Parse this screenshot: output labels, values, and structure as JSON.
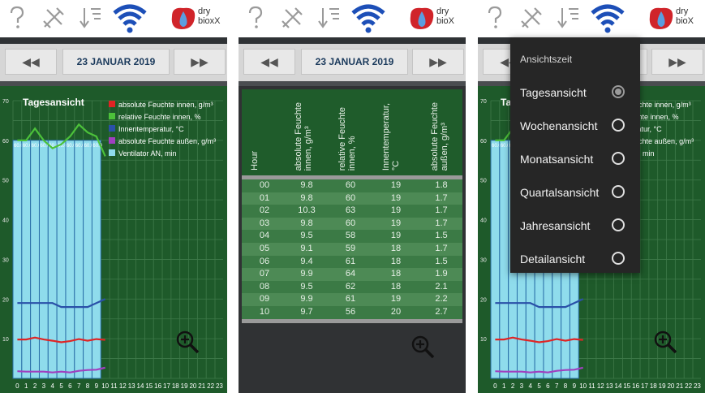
{
  "app": {
    "logo_line1": "dry",
    "logo_line2": "bioxX",
    "logo_line2_cut": "bioX"
  },
  "icons": [
    "help-icon",
    "tools-icon",
    "sort-icon",
    "wifi-icon",
    "bioxx-logo"
  ],
  "date_nav": {
    "prev": "◀◀",
    "date": "23 JANUAR 2019",
    "next": "▶▶"
  },
  "colors": {
    "chart_bg": "#1e5a2a",
    "abs_innen": "#e02424",
    "rel_innen": "#4cc13a",
    "temp": "#2a50a8",
    "abs_aussen": "#a040c0",
    "ventilator": "#8fdcec"
  },
  "chart_data": {
    "type": "line",
    "title": "Tagesansicht",
    "x": [
      0,
      1,
      2,
      3,
      4,
      5,
      6,
      7,
      8,
      9,
      10
    ],
    "x_ticks": [
      "0",
      "1",
      "2",
      "3",
      "4",
      "5",
      "6",
      "7",
      "8",
      "9",
      "10",
      "11",
      "12",
      "13",
      "14",
      "15",
      "16",
      "17",
      "18",
      "19",
      "20",
      "21",
      "22",
      "23"
    ],
    "y_ticks": [
      "10",
      "20",
      "30",
      "40",
      "50",
      "60",
      "70"
    ],
    "ylim": [
      0,
      70
    ],
    "xlim": [
      0,
      23
    ],
    "series": [
      {
        "name": "absolute Feuchte innen, g/m³",
        "values": [
          9.8,
          9.8,
          10.3,
          9.8,
          9.5,
          9.1,
          9.4,
          9.9,
          9.5,
          9.9,
          9.7
        ]
      },
      {
        "name": "relative Feuchte innen, %",
        "values": [
          60,
          60,
          63,
          60,
          58,
          59,
          61,
          64,
          62,
          61,
          56
        ]
      },
      {
        "name": "Innentemperatur, °C",
        "values": [
          19,
          19,
          19,
          19,
          19,
          18,
          18,
          18,
          18,
          19,
          20
        ]
      },
      {
        "name": "absolute Feuchte außen, g/m³",
        "values": [
          1.8,
          1.7,
          1.7,
          1.7,
          1.5,
          1.7,
          1.5,
          1.9,
          2.1,
          2.2,
          2.7
        ]
      },
      {
        "name": "Ventilator AN, min",
        "values": [
          60,
          60,
          60,
          60,
          60,
          60,
          60,
          60,
          60,
          60,
          60
        ]
      }
    ],
    "bar_labels": [
      "60.0",
      "60.0",
      "60.0",
      "60.0",
      "60.0",
      "60.0",
      "60.0",
      "60.0",
      "60.0",
      "60.0"
    ],
    "legend_position": "top-right"
  },
  "table": {
    "headers": [
      "Hour",
      "absolute Feuchte\ninnen, g/m³",
      "relative Feuchte\ninnen, %",
      "Innentemperatur,\n°C",
      "absolute Feuchte\naußen, g/m³"
    ],
    "rows": [
      [
        "00",
        "9.8",
        "60",
        "19",
        "1.8"
      ],
      [
        "01",
        "9.8",
        "60",
        "19",
        "1.7"
      ],
      [
        "02",
        "10.3",
        "63",
        "19",
        "1.7"
      ],
      [
        "03",
        "9.8",
        "60",
        "19",
        "1.7"
      ],
      [
        "04",
        "9.5",
        "58",
        "19",
        "1.5"
      ],
      [
        "05",
        "9.1",
        "59",
        "18",
        "1.7"
      ],
      [
        "06",
        "9.4",
        "61",
        "18",
        "1.5"
      ],
      [
        "07",
        "9.9",
        "64",
        "18",
        "1.9"
      ],
      [
        "08",
        "9.5",
        "62",
        "18",
        "2.1"
      ],
      [
        "09",
        "9.9",
        "61",
        "19",
        "2.2"
      ],
      [
        "10",
        "9.7",
        "56",
        "20",
        "2.7"
      ]
    ]
  },
  "menu": {
    "title": "Ansichtszeit",
    "items": [
      "Tagesansicht",
      "Wochenansicht",
      "Monatsansicht",
      "Quartalsansicht",
      "Jahresansicht",
      "Detailansicht"
    ],
    "selected": "Tagesansicht"
  }
}
